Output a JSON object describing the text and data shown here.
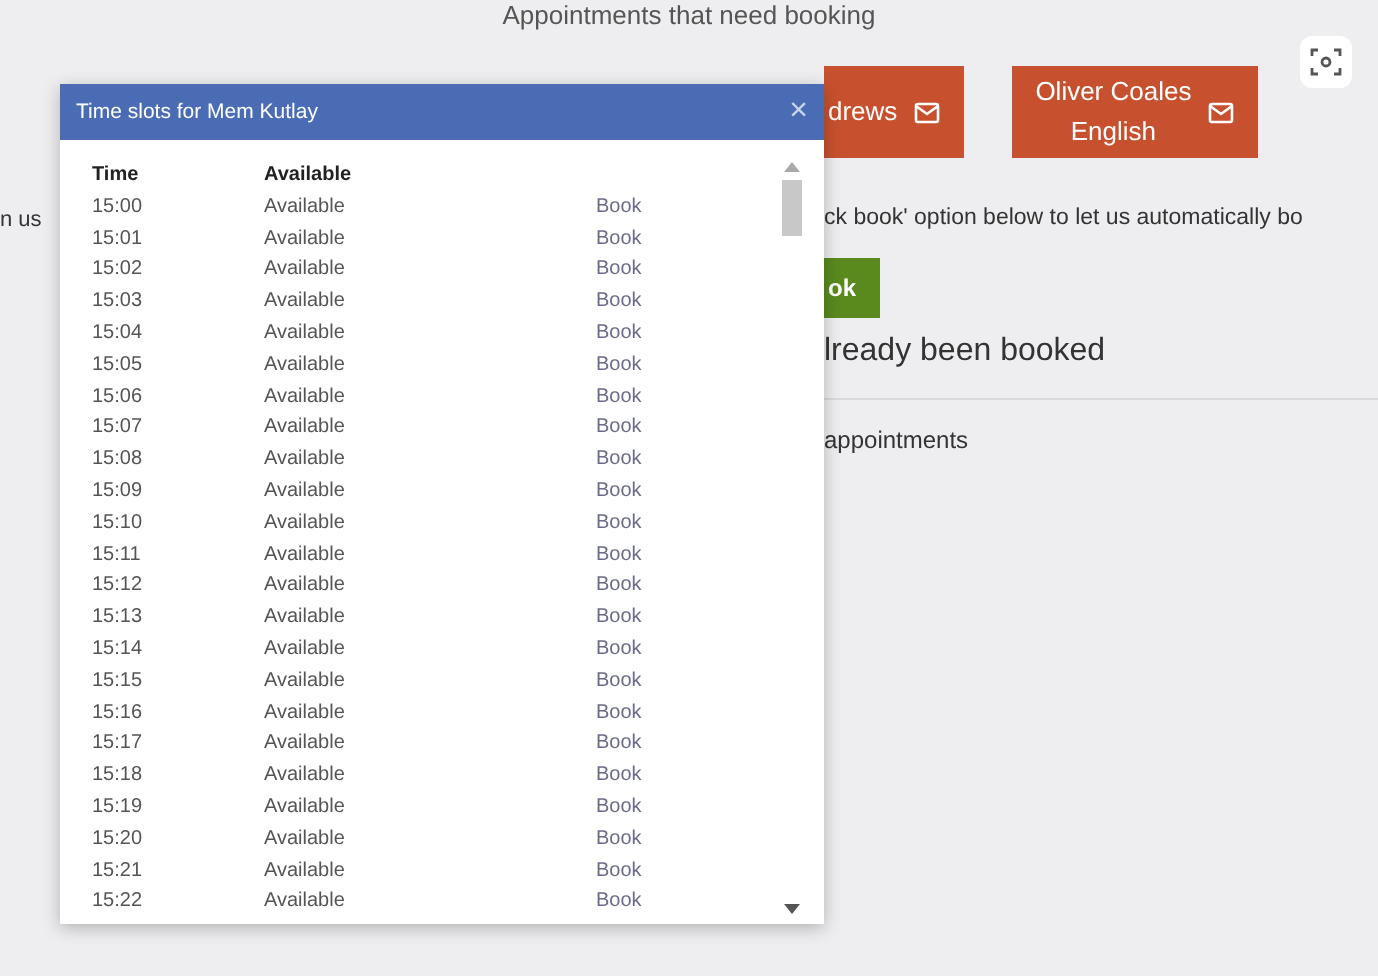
{
  "page": {
    "heading": "Appointments that need booking",
    "left_fragment": "n us",
    "teacher_buttons": [
      {
        "lines": [
          "drews"
        ]
      },
      {
        "lines": [
          "Oliver Coales",
          "English"
        ]
      }
    ],
    "intro_fragment": "ck book' option below to let us automatically bo",
    "quick_button": "ok",
    "booked_heading": "lready been booked",
    "appointments_fragment": "appointments"
  },
  "dialog": {
    "title": "Time slots for Mem Kutlay",
    "close": "×",
    "columns": [
      "Time",
      "Available"
    ],
    "rows": [
      {
        "time": "15:00",
        "status": "Available",
        "action": "Book"
      },
      {
        "time": "15:01",
        "status": "Available",
        "action": "Book"
      },
      {
        "time": "15:02",
        "status": "Available",
        "action": "Book"
      },
      {
        "time": "15:03",
        "status": "Available",
        "action": "Book"
      },
      {
        "time": "15:04",
        "status": "Available",
        "action": "Book"
      },
      {
        "time": "15:05",
        "status": "Available",
        "action": "Book"
      },
      {
        "time": "15:06",
        "status": "Available",
        "action": "Book"
      },
      {
        "time": "15:07",
        "status": "Available",
        "action": "Book"
      },
      {
        "time": "15:08",
        "status": "Available",
        "action": "Book"
      },
      {
        "time": "15:09",
        "status": "Available",
        "action": "Book"
      },
      {
        "time": "15:10",
        "status": "Available",
        "action": "Book"
      },
      {
        "time": "15:11",
        "status": "Available",
        "action": "Book"
      },
      {
        "time": "15:12",
        "status": "Available",
        "action": "Book"
      },
      {
        "time": "15:13",
        "status": "Available",
        "action": "Book"
      },
      {
        "time": "15:14",
        "status": "Available",
        "action": "Book"
      },
      {
        "time": "15:15",
        "status": "Available",
        "action": "Book"
      },
      {
        "time": "15:16",
        "status": "Available",
        "action": "Book"
      },
      {
        "time": "15:17",
        "status": "Available",
        "action": "Book"
      },
      {
        "time": "15:18",
        "status": "Available",
        "action": "Book"
      },
      {
        "time": "15:19",
        "status": "Available",
        "action": "Book"
      },
      {
        "time": "15:20",
        "status": "Available",
        "action": "Book"
      },
      {
        "time": "15:21",
        "status": "Available",
        "action": "Book"
      },
      {
        "time": "15:22",
        "status": "Available",
        "action": "Book"
      }
    ]
  }
}
